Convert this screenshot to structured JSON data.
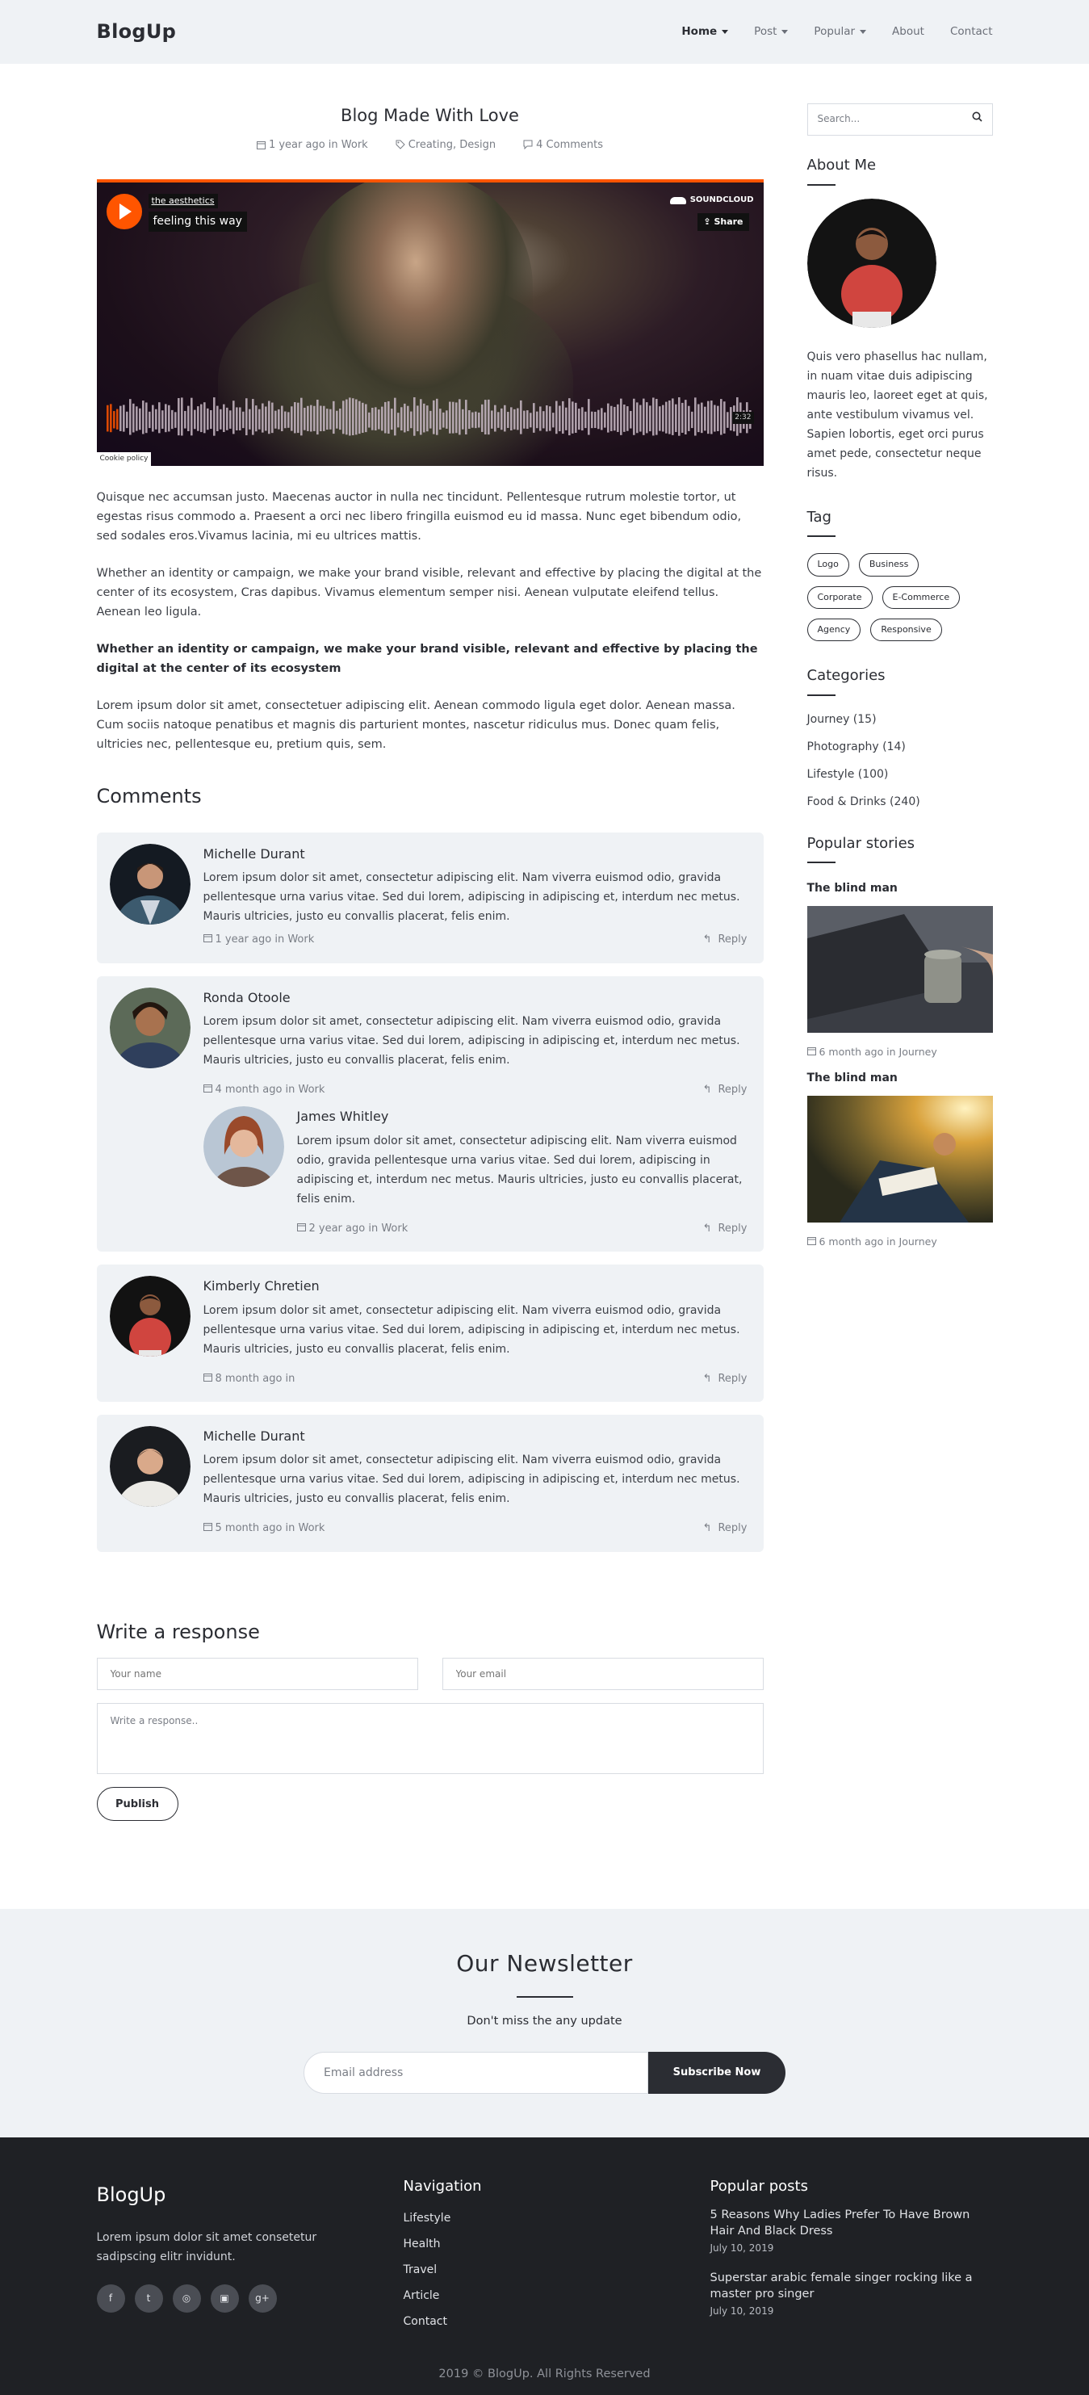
{
  "header": {
    "logo": "BlogUp",
    "nav": [
      {
        "label": "Home",
        "dropdown": true,
        "active": true
      },
      {
        "label": "Post",
        "dropdown": true
      },
      {
        "label": "Popular",
        "dropdown": true
      },
      {
        "label": "About",
        "dropdown": false
      },
      {
        "label": "Contact",
        "dropdown": false
      }
    ]
  },
  "post": {
    "title": "Blog Made With Love",
    "meta_date": "1 year ago in Work",
    "meta_tags": "Creating, Design",
    "meta_comments": "4 Comments",
    "player": {
      "user": "the aesthetics",
      "track": "feeling this way",
      "brand": "SOUNDCLOUD",
      "share": "Share",
      "duration": "2:32",
      "cookie": "Cookie policy"
    },
    "paragraphs": [
      "Quisque nec accumsan justo. Maecenas auctor in nulla nec tincidunt. Pellentesque rutrum molestie tortor, ut egestas risus commodo a. Praesent a orci nec libero fringilla euismod eu id massa. Nunc eget bibendum odio, sed sodales eros.Vivamus lacinia, mi eu ultrices mattis.",
      "Whether an identity or campaign, we make your brand visible, relevant and effective by placing the digital at the center of its ecosystem, Cras dapibus. Vivamus elementum semper nisi. Aenean vulputate eleifend tellus. Aenean leo ligula.",
      "Whether an identity or campaign, we make your brand visible, relevant and effective by placing the digital at the center of its ecosystem",
      "Lorem ipsum dolor sit amet, consectetuer adipiscing elit. Aenean commodo ligula eget dolor. Aenean massa. Cum sociis natoque penatibus et magnis dis parturient montes, nascetur ridiculus mus. Donec quam felis, ultricies nec, pellentesque eu, pretium quis, sem."
    ]
  },
  "comments_title": "Comments",
  "comments": [
    {
      "name": "Michelle Durant",
      "text": "Lorem ipsum dolor sit amet, consectetur adipiscing elit. Nam viverra euismod odio, gravida pellentesque urna varius vitae. Sed dui lorem, adipiscing in adipiscing et, interdum nec metus. Mauris ultricies, justo eu convallis placerat, felis enim.",
      "date": "1 year ago in Work",
      "reply": "Reply"
    },
    {
      "name": "Ronda Otoole",
      "text": "Lorem ipsum dolor sit amet, consectetur adipiscing elit. Nam viverra euismod odio, gravida pellentesque urna varius vitae. Sed dui lorem, adipiscing in adipiscing et, interdum nec metus. Mauris ultricies, justo eu convallis placerat, felis enim.",
      "date": "4 month ago in Work",
      "reply": "Reply",
      "nested": {
        "name": "James Whitley",
        "text": "Lorem ipsum dolor sit amet, consectetur adipiscing elit. Nam viverra euismod odio, gravida pellentesque urna varius vitae. Sed dui lorem, adipiscing in adipiscing et, interdum nec metus. Mauris ultricies, justo eu convallis placerat, felis enim.",
        "date": "2 year ago in Work",
        "reply": "Reply"
      }
    },
    {
      "name": "Kimberly Chretien",
      "text": "Lorem ipsum dolor sit amet, consectetur adipiscing elit. Nam viverra euismod odio, gravida pellentesque urna varius vitae. Sed dui lorem, adipiscing in adipiscing et, interdum nec metus. Mauris ultricies, justo eu convallis placerat, felis enim.",
      "date": "8 month ago in",
      "reply": "Reply"
    },
    {
      "name": "Michelle Durant",
      "text": "Lorem ipsum dolor sit amet, consectetur adipiscing elit. Nam viverra euismod odio, gravida pellentesque urna varius vitae. Sed dui lorem, adipiscing in adipiscing et, interdum nec metus. Mauris ultricies, justo eu convallis placerat, felis enim.",
      "date": "5 month ago in Work",
      "reply": "Reply"
    }
  ],
  "response": {
    "title": "Write a response",
    "name_placeholder": "Your name",
    "email_placeholder": "Your email",
    "message_placeholder": "Write a response..",
    "publish": "Publish"
  },
  "sidebar": {
    "search_placeholder": "Search...",
    "about_title": "About Me",
    "about_text": "Quis vero phasellus hac nullam, in nuam vitae duis adipiscing mauris leo, laoreet eget at quis, ante vestibulum vivamus vel. Sapien lobortis, eget orci purus amet pede, consectetur neque risus.",
    "tag_title": "Tag",
    "tags": [
      "Logo",
      "Business",
      "Corporate",
      "E-Commerce",
      "Agency",
      "Responsive"
    ],
    "categories_title": "Categories",
    "categories": [
      "Journey (15)",
      "Photography (14)",
      "Lifestyle (100)",
      "Food & Drinks (240)"
    ],
    "popular_title": "Popular stories",
    "stories": [
      {
        "title": "The blind man",
        "meta": "6 month ago in Journey"
      },
      {
        "title": "The blind man",
        "meta": "6 month ago in Journey"
      }
    ]
  },
  "newsletter": {
    "title": "Our Newsletter",
    "subtitle": "Don't miss the any update",
    "placeholder": "Email address",
    "button": "Subscribe Now"
  },
  "footer": {
    "logo": "BlogUp",
    "text": "Lorem ipsum dolor sit amet consetetur sadipscing elitr invidunt.",
    "socials": [
      "facebook-icon",
      "twitter-icon",
      "dribbble-icon",
      "instagram-icon",
      "google-plus-icon"
    ],
    "nav_title": "Navigation",
    "nav": [
      "Lifestyle",
      "Health",
      "Travel",
      "Article",
      "Contact"
    ],
    "posts_title": "Popular posts",
    "posts": [
      {
        "title": "5 Reasons Why Ladies Prefer To Have Brown Hair And Black Dress",
        "date": "July 10, 2019"
      },
      {
        "title": "Superstar arabic female singer rocking like a master pro singer",
        "date": "July 10, 2019"
      }
    ],
    "copyright": "2019 © BlogUp. All Rights Reserved"
  },
  "colors": {
    "accent": "#ff5500",
    "dark": "#2b2d33",
    "light_bg": "#eff2f5",
    "footer_bg": "#1f2125"
  }
}
